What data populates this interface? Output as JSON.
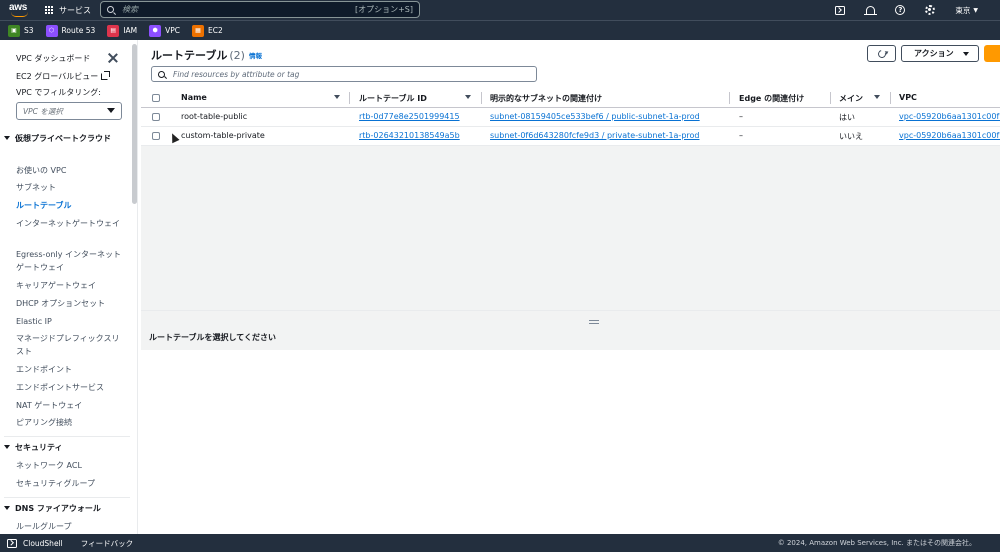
{
  "nav": {
    "logo": "aws",
    "services_label": "サービス",
    "search_placeholder": "検索",
    "search_shortcut": "[オプション+S]",
    "region": "東京"
  },
  "favorites": [
    {
      "label": "S3",
      "color": "#3f8624",
      "abbr": "S3"
    },
    {
      "label": "Route 53",
      "color": "#8c4fff",
      "abbr": "R"
    },
    {
      "label": "IAM",
      "color": "#dd344c",
      "abbr": "I"
    },
    {
      "label": "VPC",
      "color": "#8c4fff",
      "abbr": "V"
    },
    {
      "label": "EC2",
      "color": "#ed7100",
      "abbr": "E"
    }
  ],
  "sidebar": {
    "dashboard": "VPC ダッシュボード",
    "global_view": "EC2 グローバルビュー",
    "filter_label": "VPC でフィルタリング:",
    "filter_placeholder": "VPC を選択",
    "section_vpc": "仮想プライベートクラウド",
    "vpc_items": [
      "お使いの VPC",
      "サブネット",
      "ルートテーブル",
      "インターネットゲートウェイ",
      "Egress-only インターネットゲートウェイ",
      "キャリアゲートウェイ",
      "DHCP オプションセット",
      "Elastic IP",
      "マネージドプレフィックスリスト",
      "エンドポイント",
      "エンドポイントサービス",
      "NAT ゲートウェイ",
      "ピアリング接続"
    ],
    "section_security": "セキュリティ",
    "security_items": [
      "ネットワーク ACL",
      "セキュリティグループ"
    ],
    "section_dns": "DNS ファイアウォール",
    "dns_items": [
      "ルールグループ"
    ]
  },
  "main": {
    "title": "ルートテーブル",
    "count": "(2)",
    "info": "情報",
    "actions_label": "アクション",
    "filter_placeholder": "Find resources by attribute or tag",
    "columns": [
      "Name",
      "ルートテーブル ID",
      "明示的なサブネットの関連付け",
      "Edge の関連付け",
      "メイン",
      "VPC"
    ],
    "rows": [
      {
        "name": "root-table-public",
        "id": "rtb-0d77e8e2501999415",
        "subnet": "subnet-08159405ce533bef6 / public-subnet-1a-prod",
        "edge": "–",
        "main": "はい",
        "vpc": "vpc-05920b6aa1301c00f |"
      },
      {
        "name": "custom-table-private",
        "id": "rtb-02643210138549a5b",
        "subnet": "subnet-0f6d643280fcfe9d3 / private-subnet-1a-prod",
        "edge": "–",
        "main": "いいえ",
        "vpc": "vpc-05920b6aa1301c00f |"
      }
    ],
    "detail_prompt": "ルートテーブルを選択してください"
  },
  "footer": {
    "cloudshell": "CloudShell",
    "feedback": "フィードバック",
    "copyright": "© 2024, Amazon Web Services, Inc. またはその関連会社。"
  }
}
